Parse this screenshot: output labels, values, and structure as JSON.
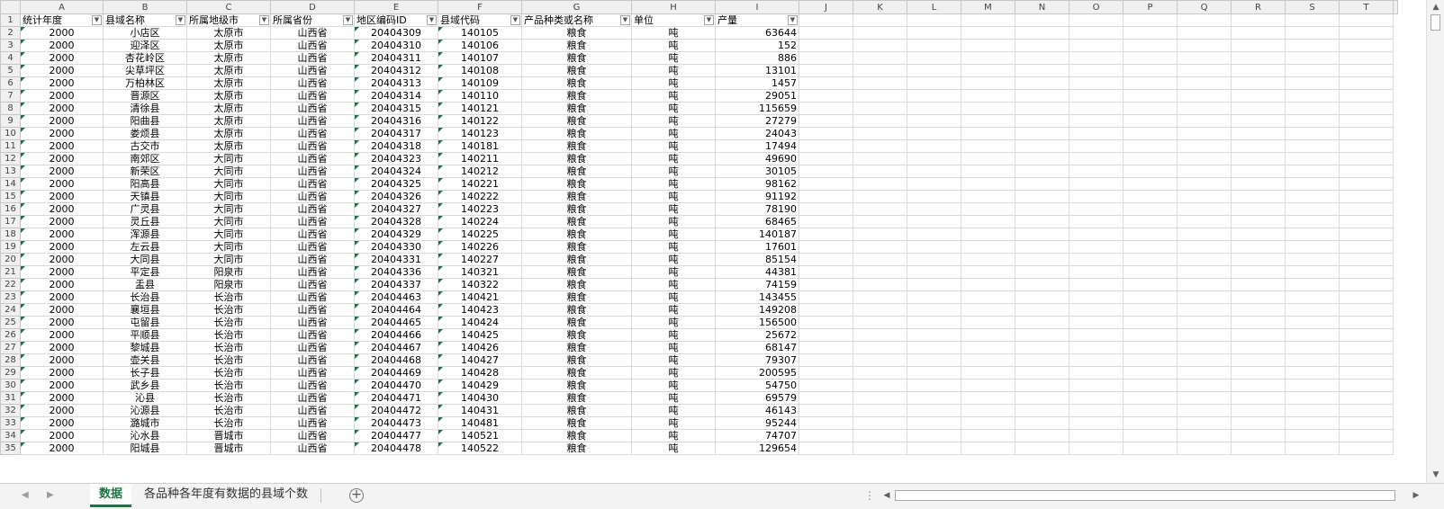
{
  "column_letters": [
    "A",
    "B",
    "C",
    "D",
    "E",
    "F",
    "G",
    "H",
    "I",
    "J",
    "K",
    "L",
    "M",
    "N",
    "O",
    "P",
    "Q",
    "R",
    "S",
    "T"
  ],
  "header_row": {
    "row_number": "1",
    "cells": [
      "统计年度",
      "县域名称",
      "所属地级市",
      "所属省份",
      "地区编码ID",
      "县域代码",
      "产品种类或名称",
      "单位",
      "产量"
    ]
  },
  "rows": [
    {
      "n": "2",
      "year": "2000",
      "county": "小店区",
      "city": "太原市",
      "province": "山西省",
      "region_id": "20404309",
      "code": "140105",
      "product": "粮食",
      "unit": "吨",
      "output": "63644"
    },
    {
      "n": "3",
      "year": "2000",
      "county": "迎泽区",
      "city": "太原市",
      "province": "山西省",
      "region_id": "20404310",
      "code": "140106",
      "product": "粮食",
      "unit": "吨",
      "output": "152"
    },
    {
      "n": "4",
      "year": "2000",
      "county": "杏花岭区",
      "city": "太原市",
      "province": "山西省",
      "region_id": "20404311",
      "code": "140107",
      "product": "粮食",
      "unit": "吨",
      "output": "886"
    },
    {
      "n": "5",
      "year": "2000",
      "county": "尖草坪区",
      "city": "太原市",
      "province": "山西省",
      "region_id": "20404312",
      "code": "140108",
      "product": "粮食",
      "unit": "吨",
      "output": "13101"
    },
    {
      "n": "6",
      "year": "2000",
      "county": "万柏林区",
      "city": "太原市",
      "province": "山西省",
      "region_id": "20404313",
      "code": "140109",
      "product": "粮食",
      "unit": "吨",
      "output": "1457"
    },
    {
      "n": "7",
      "year": "2000",
      "county": "晋源区",
      "city": "太原市",
      "province": "山西省",
      "region_id": "20404314",
      "code": "140110",
      "product": "粮食",
      "unit": "吨",
      "output": "29051"
    },
    {
      "n": "8",
      "year": "2000",
      "county": "清徐县",
      "city": "太原市",
      "province": "山西省",
      "region_id": "20404315",
      "code": "140121",
      "product": "粮食",
      "unit": "吨",
      "output": "115659"
    },
    {
      "n": "9",
      "year": "2000",
      "county": "阳曲县",
      "city": "太原市",
      "province": "山西省",
      "region_id": "20404316",
      "code": "140122",
      "product": "粮食",
      "unit": "吨",
      "output": "27279"
    },
    {
      "n": "10",
      "year": "2000",
      "county": "娄烦县",
      "city": "太原市",
      "province": "山西省",
      "region_id": "20404317",
      "code": "140123",
      "product": "粮食",
      "unit": "吨",
      "output": "24043"
    },
    {
      "n": "11",
      "year": "2000",
      "county": "古交市",
      "city": "太原市",
      "province": "山西省",
      "region_id": "20404318",
      "code": "140181",
      "product": "粮食",
      "unit": "吨",
      "output": "17494"
    },
    {
      "n": "12",
      "year": "2000",
      "county": "南郊区",
      "city": "大同市",
      "province": "山西省",
      "region_id": "20404323",
      "code": "140211",
      "product": "粮食",
      "unit": "吨",
      "output": "49690"
    },
    {
      "n": "13",
      "year": "2000",
      "county": "新荣区",
      "city": "大同市",
      "province": "山西省",
      "region_id": "20404324",
      "code": "140212",
      "product": "粮食",
      "unit": "吨",
      "output": "30105"
    },
    {
      "n": "14",
      "year": "2000",
      "county": "阳高县",
      "city": "大同市",
      "province": "山西省",
      "region_id": "20404325",
      "code": "140221",
      "product": "粮食",
      "unit": "吨",
      "output": "98162"
    },
    {
      "n": "15",
      "year": "2000",
      "county": "天镇县",
      "city": "大同市",
      "province": "山西省",
      "region_id": "20404326",
      "code": "140222",
      "product": "粮食",
      "unit": "吨",
      "output": "91192"
    },
    {
      "n": "16",
      "year": "2000",
      "county": "广灵县",
      "city": "大同市",
      "province": "山西省",
      "region_id": "20404327",
      "code": "140223",
      "product": "粮食",
      "unit": "吨",
      "output": "78190"
    },
    {
      "n": "17",
      "year": "2000",
      "county": "灵丘县",
      "city": "大同市",
      "province": "山西省",
      "region_id": "20404328",
      "code": "140224",
      "product": "粮食",
      "unit": "吨",
      "output": "68465"
    },
    {
      "n": "18",
      "year": "2000",
      "county": "浑源县",
      "city": "大同市",
      "province": "山西省",
      "region_id": "20404329",
      "code": "140225",
      "product": "粮食",
      "unit": "吨",
      "output": "140187"
    },
    {
      "n": "19",
      "year": "2000",
      "county": "左云县",
      "city": "大同市",
      "province": "山西省",
      "region_id": "20404330",
      "code": "140226",
      "product": "粮食",
      "unit": "吨",
      "output": "17601"
    },
    {
      "n": "20",
      "year": "2000",
      "county": "大同县",
      "city": "大同市",
      "province": "山西省",
      "region_id": "20404331",
      "code": "140227",
      "product": "粮食",
      "unit": "吨",
      "output": "85154"
    },
    {
      "n": "21",
      "year": "2000",
      "county": "平定县",
      "city": "阳泉市",
      "province": "山西省",
      "region_id": "20404336",
      "code": "140321",
      "product": "粮食",
      "unit": "吨",
      "output": "44381"
    },
    {
      "n": "22",
      "year": "2000",
      "county": "盂县",
      "city": "阳泉市",
      "province": "山西省",
      "region_id": "20404337",
      "code": "140322",
      "product": "粮食",
      "unit": "吨",
      "output": "74159"
    },
    {
      "n": "23",
      "year": "2000",
      "county": "长治县",
      "city": "长治市",
      "province": "山西省",
      "region_id": "20404463",
      "code": "140421",
      "product": "粮食",
      "unit": "吨",
      "output": "143455"
    },
    {
      "n": "24",
      "year": "2000",
      "county": "襄垣县",
      "city": "长治市",
      "province": "山西省",
      "region_id": "20404464",
      "code": "140423",
      "product": "粮食",
      "unit": "吨",
      "output": "149208"
    },
    {
      "n": "25",
      "year": "2000",
      "county": "屯留县",
      "city": "长治市",
      "province": "山西省",
      "region_id": "20404465",
      "code": "140424",
      "product": "粮食",
      "unit": "吨",
      "output": "156500"
    },
    {
      "n": "26",
      "year": "2000",
      "county": "平顺县",
      "city": "长治市",
      "province": "山西省",
      "region_id": "20404466",
      "code": "140425",
      "product": "粮食",
      "unit": "吨",
      "output": "25672"
    },
    {
      "n": "27",
      "year": "2000",
      "county": "黎城县",
      "city": "长治市",
      "province": "山西省",
      "region_id": "20404467",
      "code": "140426",
      "product": "粮食",
      "unit": "吨",
      "output": "68147"
    },
    {
      "n": "28",
      "year": "2000",
      "county": "壶关县",
      "city": "长治市",
      "province": "山西省",
      "region_id": "20404468",
      "code": "140427",
      "product": "粮食",
      "unit": "吨",
      "output": "79307"
    },
    {
      "n": "29",
      "year": "2000",
      "county": "长子县",
      "city": "长治市",
      "province": "山西省",
      "region_id": "20404469",
      "code": "140428",
      "product": "粮食",
      "unit": "吨",
      "output": "200595"
    },
    {
      "n": "30",
      "year": "2000",
      "county": "武乡县",
      "city": "长治市",
      "province": "山西省",
      "region_id": "20404470",
      "code": "140429",
      "product": "粮食",
      "unit": "吨",
      "output": "54750"
    },
    {
      "n": "31",
      "year": "2000",
      "county": "沁县",
      "city": "长治市",
      "province": "山西省",
      "region_id": "20404471",
      "code": "140430",
      "product": "粮食",
      "unit": "吨",
      "output": "69579"
    },
    {
      "n": "32",
      "year": "2000",
      "county": "沁源县",
      "city": "长治市",
      "province": "山西省",
      "region_id": "20404472",
      "code": "140431",
      "product": "粮食",
      "unit": "吨",
      "output": "46143"
    },
    {
      "n": "33",
      "year": "2000",
      "county": "潞城市",
      "city": "长治市",
      "province": "山西省",
      "region_id": "20404473",
      "code": "140481",
      "product": "粮食",
      "unit": "吨",
      "output": "95244"
    },
    {
      "n": "34",
      "year": "2000",
      "county": "沁水县",
      "city": "晋城市",
      "province": "山西省",
      "region_id": "20404477",
      "code": "140521",
      "product": "粮食",
      "unit": "吨",
      "output": "74707"
    },
    {
      "n": "35",
      "year": "2000",
      "county": "阳城县",
      "city": "晋城市",
      "province": "山西省",
      "region_id": "20404478",
      "code": "140522",
      "product": "粮食",
      "unit": "吨",
      "output": "129654"
    }
  ],
  "sheet_tabs": [
    {
      "label": "数据",
      "active": true
    },
    {
      "label": "各品种各年度有数据的县域个数",
      "active": false
    }
  ],
  "icons": {
    "filter": "dropdown-arrow-icon",
    "add_sheet": "plus-circle-icon",
    "scroll_up": "triangle-up-icon",
    "scroll_down": "triangle-down-icon",
    "scroll_left": "triangle-left-icon",
    "scroll_right": "triangle-right-icon"
  },
  "colors": {
    "accent": "#217346",
    "error_triangle": "#1e7145",
    "header_bg": "#f0f0f0",
    "gridline": "#d9d9d9"
  }
}
